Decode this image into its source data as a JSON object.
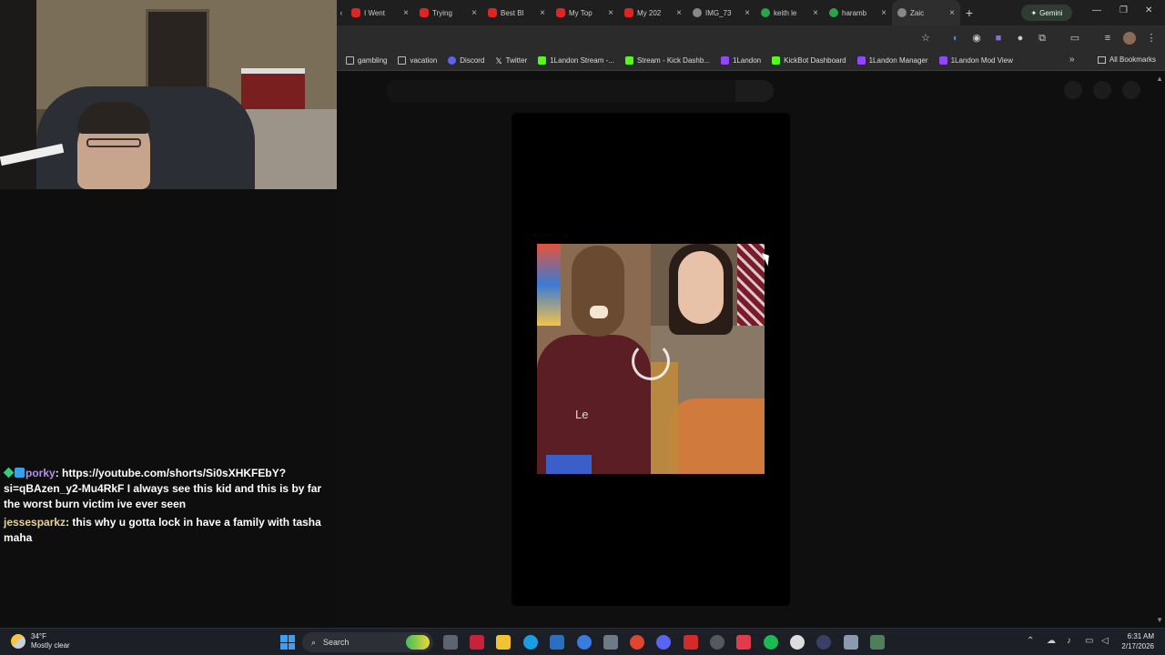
{
  "browser": {
    "tabs": [
      {
        "label": "I Went",
        "icon": "youtube-icon"
      },
      {
        "label": "Trying",
        "icon": "youtube-icon"
      },
      {
        "label": "Best Bl",
        "icon": "youtube-icon"
      },
      {
        "label": "My Top",
        "icon": "youtube-icon"
      },
      {
        "label": "My 202",
        "icon": "youtube-icon"
      },
      {
        "label": "IMG_73",
        "icon": "web-icon"
      },
      {
        "label": "keith le",
        "icon": "google-icon"
      },
      {
        "label": "haramb",
        "icon": "google-icon"
      },
      {
        "label": "Zaic",
        "icon": "web-icon",
        "active": true
      }
    ],
    "new_tab": "+",
    "gemini_label": "Gemini",
    "bookmarks": [
      {
        "label": "gambling",
        "icon": "folder-icon"
      },
      {
        "label": "vacation",
        "icon": "folder-icon"
      },
      {
        "label": "Discord",
        "icon": "discord-icon"
      },
      {
        "label": "Twitter",
        "icon": "x-icon"
      },
      {
        "label": "1Landon Stream -...",
        "icon": "kick-icon"
      },
      {
        "label": "Stream - Kick Dashb...",
        "icon": "kick-icon"
      },
      {
        "label": "1Landon",
        "icon": "twitch-icon"
      },
      {
        "label": "KickBot Dashboard",
        "icon": "kick-icon"
      },
      {
        "label": "1Landon Manager",
        "icon": "twitch-icon"
      },
      {
        "label": "1Landon Mod View",
        "icon": "twitch-icon"
      }
    ],
    "bookmarks_more": "»",
    "all_bookmarks": "All Bookmarks"
  },
  "video": {
    "shirt_text": "Le",
    "state": "loading"
  },
  "chat": {
    "messages": [
      {
        "user": "porky",
        "sep": ":",
        "text": "https://youtube.com/shorts/Si0sXHKFEbY?si=qBAzen_y2-Mu4RkF I always see this kid and this is by far the worst burn victim ive ever seen"
      },
      {
        "user": "jessesparkz",
        "sep": ":",
        "text": "this why u gotta lock in have a family with tasha maha"
      }
    ]
  },
  "taskbar": {
    "weather_temp": "34°F",
    "weather_desc": "Mostly clear",
    "search_label": "Search",
    "time": "6:31 AM",
    "date": "2/17/2026"
  },
  "colors": {
    "accent_tab": "#2e2e2e",
    "chat_user1": "#b58ee8",
    "chat_user2": "#e7d29a"
  }
}
